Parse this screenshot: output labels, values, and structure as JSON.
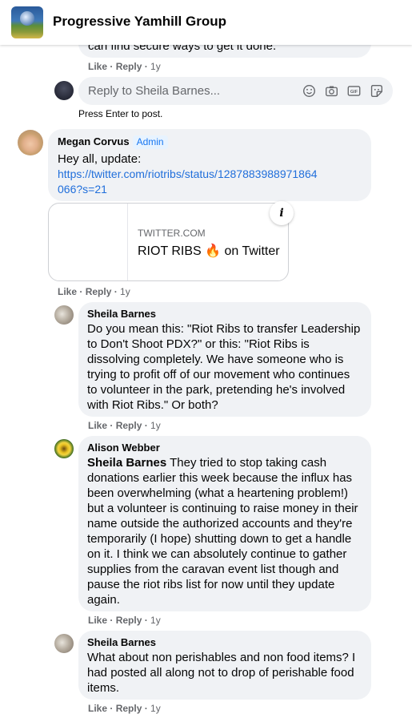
{
  "group": {
    "name": "Progressive Yamhill Group"
  },
  "prev_comment": {
    "text_tail": "can find secure ways to get it done.",
    "like": "Like",
    "reply": "Reply",
    "time": "1y"
  },
  "reply_box": {
    "placeholder": "Reply to Sheila Barnes...",
    "hint": "Press Enter to post."
  },
  "comments": [
    {
      "author": "Megan Corvus",
      "badge": "Admin",
      "text": "Hey all, update:",
      "link": "https://twitter.com/riotribs/status/1287883988971864066?s=21",
      "card": {
        "domain": "TWITTER.COM",
        "title": "RIOT RIBS 🔥 on Twitter",
        "info": "i"
      },
      "like": "Like",
      "reply": "Reply",
      "time": "1y"
    },
    {
      "author": "Sheila Barnes",
      "text": "Do you mean this: \"Riot Ribs to transfer Leadership to Don't Shoot PDX?\" or this: \"Riot Ribs is dissolving completely. We have someone who is trying to profit off of our movement who continues to volunteer in the park, pretending he's involved with Riot Ribs.\" Or both?",
      "like": "Like",
      "reply": "Reply",
      "time": "1y"
    },
    {
      "author": "Alison Webber",
      "mention": "Sheila Barnes",
      "text": " They tried to stop taking cash donations earlier this week because the influx has been overwhelming (what a heartening problem!) but a volunteer is continuing to raise money in their name outside the authorized accounts and they're temporarily (I hope) shutting down to get a handle on it. I think we can absolutely continue to gather supplies from the caravan event list though and pause the riot ribs list for now until they update again.",
      "like": "Like",
      "reply": "Reply",
      "time": "1y"
    },
    {
      "author": "Sheila Barnes",
      "text": "What about non perishables and non food items? I had posted all along not to drop of perishable food items.",
      "like": "Like",
      "reply": "Reply",
      "time": "1y"
    }
  ],
  "colors": {
    "link": "#216fdb",
    "bubble": "#f0f2f5",
    "muted": "#65676b",
    "admin_bg": "#e7f3ff"
  }
}
